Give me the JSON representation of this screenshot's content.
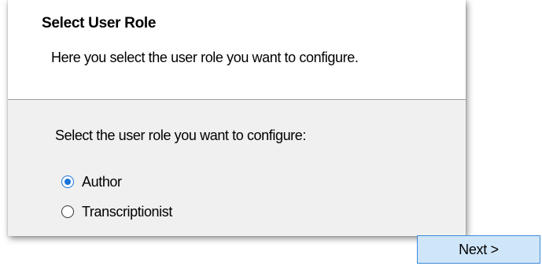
{
  "header": {
    "title": "Select User Role",
    "subtitle": "Here you select the user role you want to configure."
  },
  "main": {
    "prompt": "Select the user role you want to configure:",
    "roles": [
      {
        "label": "Author",
        "selected": true
      },
      {
        "label": "Transcriptionist",
        "selected": false
      }
    ]
  },
  "footer": {
    "next_label": "Next >"
  },
  "colors": {
    "header_background": "#ffffff",
    "body_background": "#f0f0f0",
    "radio_accent": "#1a73d9",
    "button_background": "#cfe6f9",
    "button_border": "#3b8ad9"
  }
}
